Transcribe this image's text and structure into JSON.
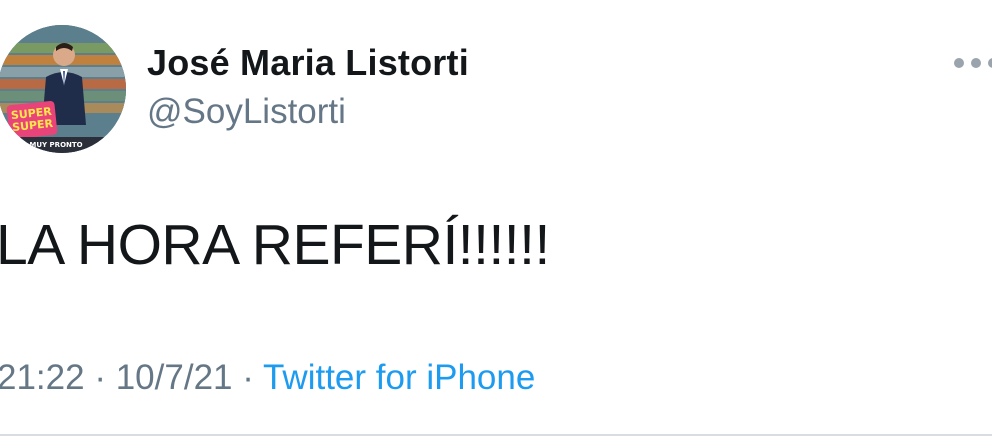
{
  "author": {
    "name": "José Maria Listorti",
    "handle": "@SoyListorti",
    "avatar_badge": "SUPER SUPER",
    "avatar_caption": "MUY PRONTO"
  },
  "tweet": {
    "text": "LA HORA REFERÍ!!!!!!",
    "time": "21:22",
    "date": "10/7/21",
    "separator": "·",
    "source": "Twitter for iPhone"
  },
  "icons": {
    "more": "more-dots-icon"
  },
  "colors": {
    "name": "#14171a",
    "secondary": "#657786",
    "link": "#1d9bf0",
    "divider": "#d8dde1"
  }
}
